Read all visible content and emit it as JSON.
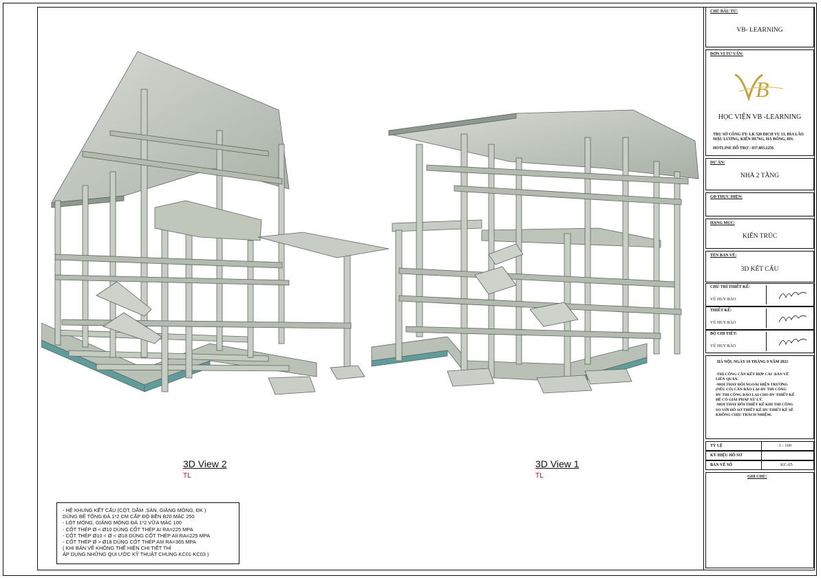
{
  "views": [
    {
      "title": "3D View 2",
      "scale": "TL"
    },
    {
      "title": "3D View 1",
      "scale": "TL"
    }
  ],
  "notes": [
    "- HỆ KHUNG KẾT CẤU (CỘT, DẦM ,SÀN, GIẰNG MÓNG, ĐK )",
    "   DÙNG BÊ TÔNG ĐÁ 1*2 CM CẤP ĐỘ BỀN B20 MÁC 250",
    "- LÓT MÓNG, GIẰNG MÓNG ĐÁ 1*2 VỮA MÁC 100",
    "- CỐT THÉP Ø < Ø10 DÙNG CỐT THÉP AI RA=225 MPA",
    "- CỐT THÉP Ø10 < Ø < Ø18 DÙNG CỐT THÉP AII RA=225 MPA",
    "- CỐT THÉP Ø > Ø18 DÙNG CỐT THÉP AIII RA=365 MPA",
    "  ( KHI BẢN VẼ KHÔNG THỂ HIỆN CHI TIẾT THÌ",
    "ÁP DỤNG NHỮNG QUI ƯỚC KỸ THUẬT CHUNG KC01-KC03 )"
  ],
  "title_block": {
    "investor_label": "CHỦ ĐẦU TƯ:",
    "investor": "VB- LEARNING",
    "consultant_label": "ĐƠN VỊ TƯ VẤN:",
    "logo_text": "VB",
    "consultant": "HỌC VIỆN VB -LEARNING",
    "address": "TRỤ SỞ CÔNG TY:  LK 520  DỊCH VỤ 13, ĐÌA LÃO MẬU LƯƠNG, KIẾN HƯNG, HÀ ĐÔNG, HN.",
    "hotline": "HOTLINE HỖ TRỢ : 037.883.2256",
    "project_label": "DỰ ÁN:",
    "project": "NHÀ 2 TẦNG",
    "director_label": "GĐ THỰC HIỆN:",
    "category_label": "HẠNG MỤC:",
    "category": "KIẾN TRÚC",
    "drawing_name_label": "TÊN BẢN VẼ:",
    "drawing_name": "3D KẾT CẤU",
    "chief_designer_label": "CHỦ TRÌ THIẾT KẾ:",
    "chief_designer": "VŨ HUY BẢO",
    "designer_label": "THIẾT KẾ:",
    "designer": "VŨ HUY BẢO",
    "detailer_label": "BỘ CHI TIẾT:",
    "detailer": "VŨ HUY BẢO",
    "date": "HÀ NỘI, NGÀY 10 THÁNG  9 NĂM 2021",
    "remarks": [
      "-THI CÔNG CẦN KẾT HỢP CÁC BẢN VẼ",
      "LIÊN QUAN.",
      "-MỌI THAY ĐỔI NGOÀI HIỆN TRƯỜNG",
      "(NẾU CÓ) CẦN BÁO LẠI ĐV THI CÔNG",
      "ĐV THI CÔNG BÁO LẠI CHO ĐV THIẾT KẾ",
      "ĐỂ CÓ GIẢI PHÁP XỬ LÝ.",
      "-MỌI THAY ĐỔI THIẾT KẾ KHI THI CÔNG",
      "SO VỚI HỒ SƠ THIẾT KẾ ĐV THIẾT KẾ SẼ",
      "KHÔNG CHỊU TRÁCH NHIỆM."
    ],
    "scale_label": "TỶ LỆ",
    "scale": "1 : 100",
    "file_code_label": "KÝ HIỆU HỒ SƠ",
    "sheet_no_label": "BẢN VẼ SỐ",
    "sheet_no": "KC-05",
    "notes_label": "GHI CHÚ:"
  },
  "colors": {
    "concrete": "#c9cfc6",
    "concrete_dark": "#9aa39a",
    "footing_edge": "#5f9c9c",
    "red": "#d60000",
    "logo_gold": "#c9a13a"
  }
}
